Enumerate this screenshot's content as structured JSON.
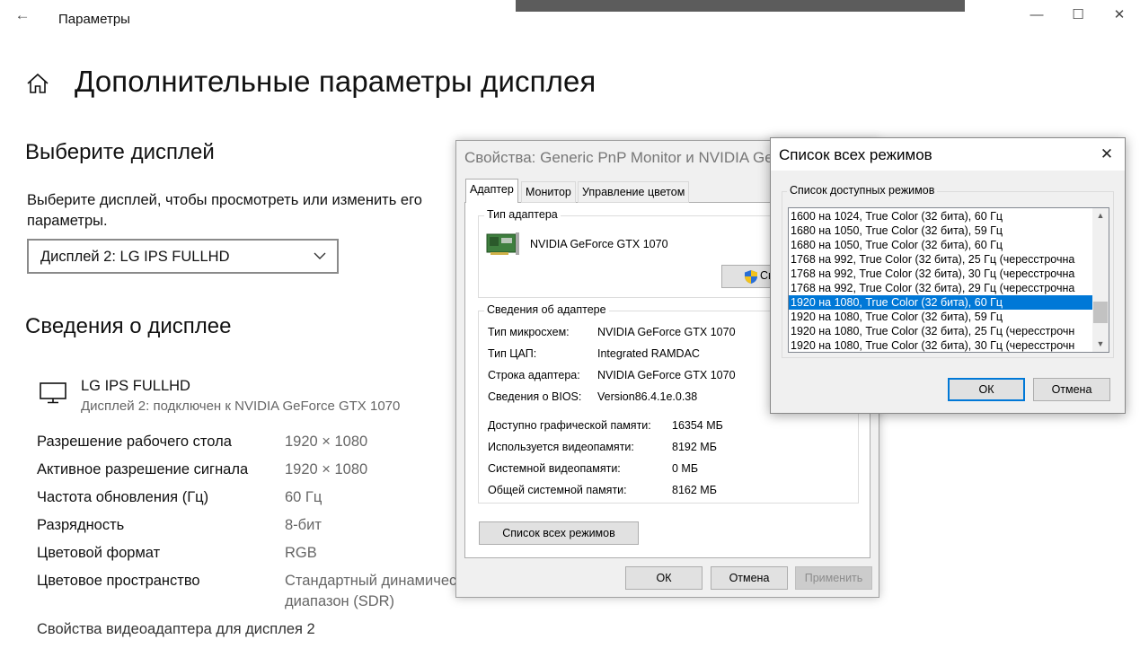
{
  "window": {
    "title": "Параметры",
    "back_glyph": "←",
    "minimize_glyph": "—",
    "maximize_glyph": "☐",
    "close_glyph": "✕"
  },
  "page": {
    "title": "Дополнительные параметры дисплея"
  },
  "select_display": {
    "heading": "Выберите дисплей",
    "description": "Выберите дисплей, чтобы просмотреть или изменить его параметры.",
    "selected": "Дисплей 2: LG IPS FULLHD"
  },
  "display_info": {
    "heading": "Сведения о дисплее",
    "monitor_name": "LG IPS FULLHD",
    "monitor_subtitle": "Дисплей 2: подключен к NVIDIA GeForce GTX 1070",
    "properties": [
      {
        "label": "Разрешение рабочего стола",
        "value": "1920 × 1080"
      },
      {
        "label": "Активное разрешение сигнала",
        "value": "1920 × 1080"
      },
      {
        "label": "Частота обновления (Гц)",
        "value": "60 Гц"
      },
      {
        "label": "Разрядность",
        "value": "8-бит"
      },
      {
        "label": "Цветовой формат",
        "value": "RGB"
      },
      {
        "label": "Цветовое пространство",
        "value": "Стандартный динамический",
        "value2": "диапазон (SDR)"
      }
    ],
    "adapter_link": "Свойства видеоадаптера для дисплея 2"
  },
  "adapter_dialog": {
    "title": "Свойства: Generic PnP Monitor и NVIDIA GeForce GTX 1070",
    "tabs": [
      "Адаптер",
      "Монитор",
      "Управление цветом"
    ],
    "adapter_type": {
      "legend": "Тип адаптера",
      "name": "NVIDIA GeForce GTX 1070",
      "properties_button": "Свойства"
    },
    "adapter_info": {
      "legend": "Сведения об адаптере",
      "rows": [
        {
          "label": "Тип микросхем:",
          "value": "NVIDIA GeForce GTX 1070"
        },
        {
          "label": "Тип ЦАП:",
          "value": "Integrated RAMDAC"
        },
        {
          "label": "Строка адаптера:",
          "value": "NVIDIA GeForce GTX 1070"
        },
        {
          "label": "Сведения о BIOS:",
          "value": "Version86.4.1e.0.38"
        }
      ],
      "memory": [
        {
          "label": "Доступно графической памяти:",
          "value": "16354 МБ"
        },
        {
          "label": "Используется видеопамяти:",
          "value": "8192 МБ"
        },
        {
          "label": "Системной видеопамяти:",
          "value": "0 МБ"
        },
        {
          "label": "Общей системной памяти:",
          "value": "8162 МБ"
        }
      ]
    },
    "list_modes_button": "Список всех режимов",
    "ok": "ОК",
    "cancel": "Отмена",
    "apply": "Применить"
  },
  "modes_dialog": {
    "title": "Список всех режимов",
    "close_glyph": "✕",
    "group_label": "Список доступных режимов",
    "modes": [
      "1600 на 1024, True Color (32 бита), 60 Гц",
      "1680 на 1050, True Color (32 бита), 59 Гц",
      "1680 на 1050, True Color (32 бита), 60 Гц",
      "1768 на 992, True Color (32 бита), 25 Гц (чересстрочна",
      "1768 на 992, True Color (32 бита), 30 Гц (чересстрочна",
      "1768 на 992, True Color (32 бита), 29 Гц (чересстрочна",
      "1920 на 1080, True Color (32 бита), 60 Гц",
      "1920 на 1080, True Color (32 бита), 59 Гц",
      "1920 на 1080, True Color (32 бита), 25 Гц (чересстрочн",
      "1920 на 1080, True Color (32 бита), 30 Гц (чересстрочн"
    ],
    "selected_index": 6,
    "ok": "ОК",
    "cancel": "Отмена"
  },
  "colors": {
    "accent": "#0078d7",
    "dialog_bg": "#f0f0f0",
    "muted_text": "#666666"
  }
}
